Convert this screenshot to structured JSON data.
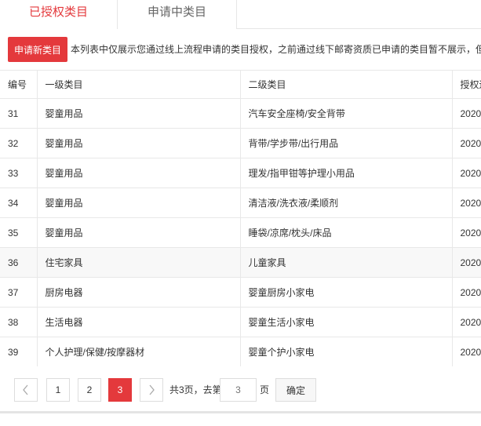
{
  "tabs": [
    {
      "label": "已授权类目",
      "active": true
    },
    {
      "label": "申请中类目",
      "active": false
    }
  ],
  "notice": {
    "button_label": "申请新类目",
    "text": "本列表中仅展示您通过线上流程申请的类目授权，之前通过线下邮寄资质已申请的类目暂不展示，但不影响"
  },
  "table": {
    "headers": [
      "编号",
      "一级类目",
      "二级类目",
      "授权运"
    ],
    "rows": [
      {
        "id": "31",
        "level1": "婴童用品",
        "level2": "汽车安全座椅/安全背带",
        "date": "2020"
      },
      {
        "id": "32",
        "level1": "婴童用品",
        "level2": "背带/学步带/出行用品",
        "date": "2020"
      },
      {
        "id": "33",
        "level1": "婴童用品",
        "level2": "理发/指甲钳等护理小用品",
        "date": "2020"
      },
      {
        "id": "34",
        "level1": "婴童用品",
        "level2": "清洁液/洗衣液/柔顺剂",
        "date": "2020"
      },
      {
        "id": "35",
        "level1": "婴童用品",
        "level2": "睡袋/凉席/枕头/床品",
        "date": "2020"
      },
      {
        "id": "36",
        "level1": "住宅家具",
        "level2": "儿童家具",
        "date": "2020"
      },
      {
        "id": "37",
        "level1": "厨房电器",
        "level2": "婴童厨房小家电",
        "date": "2020"
      },
      {
        "id": "38",
        "level1": "生活电器",
        "level2": "婴童生活小家电",
        "date": "2020"
      },
      {
        "id": "39",
        "level1": "个人护理/保健/按摩器材",
        "level2": "婴童个护小家电",
        "date": "2020"
      }
    ]
  },
  "pagination": {
    "prev_icon": "chevron-left-icon",
    "next_icon": "chevron-right-icon",
    "pages": [
      "1",
      "2",
      "3"
    ],
    "current": "3",
    "total_text": "共3页，去第",
    "input_placeholder": "3",
    "page_suffix": "页",
    "confirm_label": "确定"
  },
  "colors": {
    "accent": "#e4393c",
    "border": "#e8e8e8",
    "row_alt": "#f8f8f8"
  }
}
